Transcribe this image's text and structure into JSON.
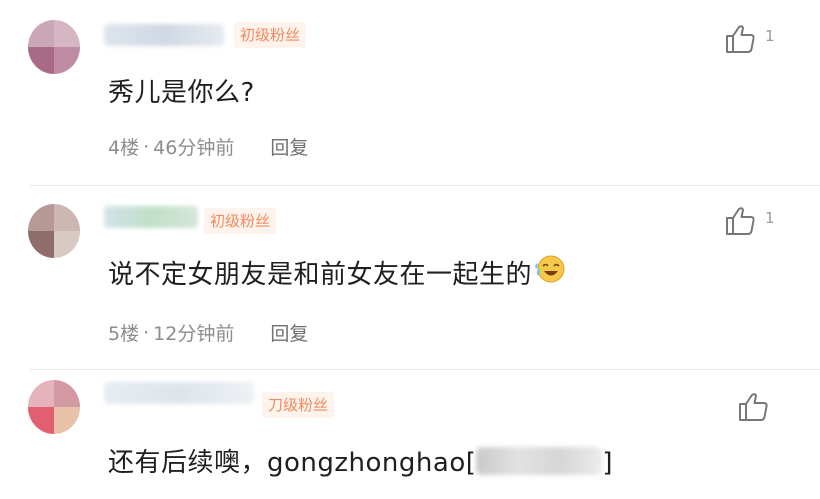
{
  "comments": [
    {
      "badge": "初级粉丝",
      "text": "秀儿是你么?",
      "floor": "4楼",
      "separator": "·",
      "time": "46分钟前",
      "reply_label": "回复",
      "like_count": "1"
    },
    {
      "badge": "初级粉丝",
      "text": "说不定女朋友是和前女友在一起生的",
      "emoji": "crying-laughing-face",
      "floor": "5楼",
      "separator": "·",
      "time": "12分钟前",
      "reply_label": "回复",
      "like_count": "1"
    },
    {
      "badge": "刀级粉丝",
      "text": "还有后续噢，gongzhonghao[",
      "text_end": "]"
    }
  ],
  "colors": {
    "badge_text": "#f08a5d",
    "badge_bg": "#fff3ee",
    "meta_text": "#8d8d8d",
    "icon": "#777777"
  },
  "icons": {
    "like": "thumbs-up-icon"
  }
}
